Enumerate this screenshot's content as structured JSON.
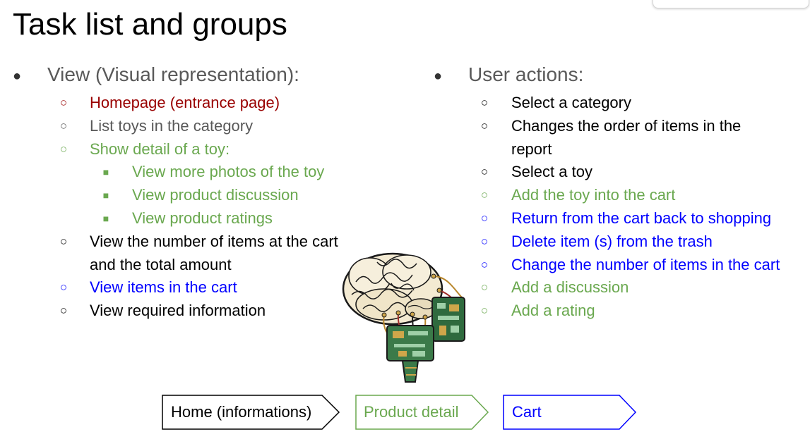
{
  "title": "Task list and groups",
  "left": {
    "heading": "View (Visual representation):",
    "items": [
      {
        "text": "Homepage (entrance page)",
        "color": "#990000"
      },
      {
        "text": "List toys in the category",
        "color": "#595959"
      },
      {
        "text": "Show detail of a toy:",
        "color": "#6aa84f"
      },
      {
        "text": "View more photos of the toy",
        "color": "#6aa84f"
      },
      {
        "text": "View product discussion",
        "color": "#6aa84f"
      },
      {
        "text": "View product ratings",
        "color": "#6aa84f"
      },
      {
        "text": "View the number of items at the cart",
        "text2": "and the total amount",
        "color": "#000000"
      },
      {
        "text": "View items in the cart",
        "color": "#0000ff"
      },
      {
        "text": "View required information",
        "color": "#000000"
      }
    ]
  },
  "right": {
    "heading": "User actions:",
    "items": [
      {
        "text": "Select a category",
        "color": "#000000"
      },
      {
        "text": "Changes the order of items in the",
        "text2": "report",
        "color": "#000000"
      },
      {
        "text": "Select a toy",
        "color": "#000000"
      },
      {
        "text": "Add the toy into the cart",
        "color": "#6aa84f"
      },
      {
        "text": "Return from the cart back to shopping",
        "color": "#0000ff"
      },
      {
        "text": "Delete item (s) from the trash",
        "color": "#0000ff"
      },
      {
        "text": "Change the number of items in the cart",
        "color": "#0000ff"
      },
      {
        "text": "Add a discussion",
        "color": "#6aa84f"
      },
      {
        "text": "Add a rating",
        "color": "#6aa84f"
      }
    ]
  },
  "flow": {
    "home": "Home (informations)",
    "product": "Product detail",
    "cart": "Cart",
    "home_color": "#000000",
    "product_color": "#6aa84f",
    "cart_color": "#0000ff"
  },
  "icons": {
    "level1_bullet": "filled-circle",
    "level2_bullet": "hollow-circle",
    "level3_bullet": "filled-square",
    "illustration": "cyber-brain-illustration"
  }
}
